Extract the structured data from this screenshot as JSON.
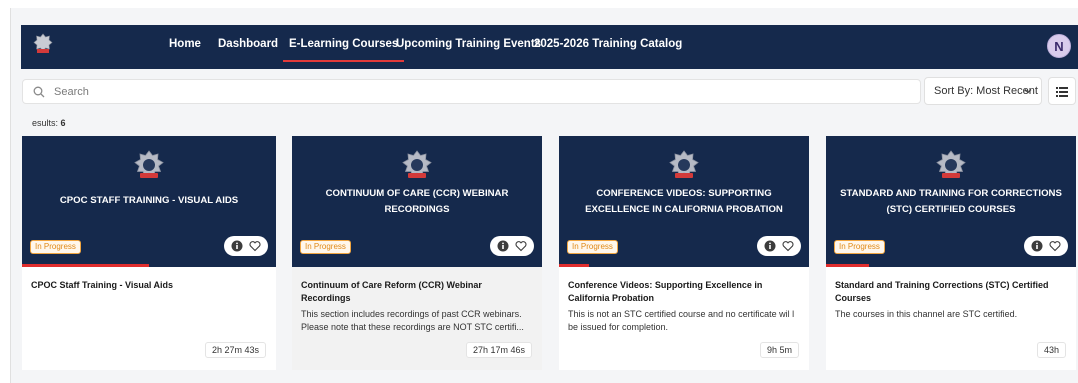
{
  "nav": {
    "items": [
      {
        "label": "Home",
        "active": false
      },
      {
        "label": "Dashboard",
        "active": false
      },
      {
        "label": "E-Learning Courses",
        "active": true
      },
      {
        "label": "Upcoming Training Events",
        "active": false
      },
      {
        "label": "2025-2026 Training Catalog",
        "active": false
      }
    ],
    "avatar_initial": "N"
  },
  "search": {
    "placeholder": "Search",
    "icon": "search-icon"
  },
  "sort": {
    "label": "Sort By: Most Recent"
  },
  "results": {
    "label": "esults:",
    "count": "6"
  },
  "colors": {
    "navy": "#15294c",
    "accent_red": "#e23a3a",
    "status_orange": "#e08a18"
  },
  "cards": [
    {
      "banner_title": "CPOC STAFF TRAINING - VISUAL AIDS",
      "status": "In Progress",
      "progress": 0.5,
      "title": "CPOC Staff Training - Visual Aids",
      "description": "",
      "duration": "2h 27m 43s"
    },
    {
      "banner_title": "CONTINUUM OF CARE (CCR) WEBINAR RECORDINGS",
      "status": "In Progress",
      "progress": 0,
      "title": "Continuum of Care Reform (CCR) Webinar Recordings",
      "description": "This section includes recordings of past CCR webinars. Please note that these recordings are NOT STC certifi...",
      "duration": "27h 17m 46s"
    },
    {
      "banner_title": "CONFERENCE VIDEOS: SUPPORTING EXCELLENCE IN CALIFORNIA PROBATION",
      "status": "In Progress",
      "progress": 0.12,
      "title": "Conference Videos: Supporting Excellence in California Probation",
      "description": "This is not an STC certified course and no certificate wil l be issued for completion.",
      "duration": "9h 5m"
    },
    {
      "banner_title": "STANDARD AND TRAINING FOR CORRECTIONS (STC) CERTIFIED COURSES",
      "status": "In Progress",
      "progress": 0.17,
      "title": "Standard and Training Corrections (STC) Certified Courses",
      "description": "The courses in this channel are STC certified.",
      "duration": "43h"
    }
  ]
}
